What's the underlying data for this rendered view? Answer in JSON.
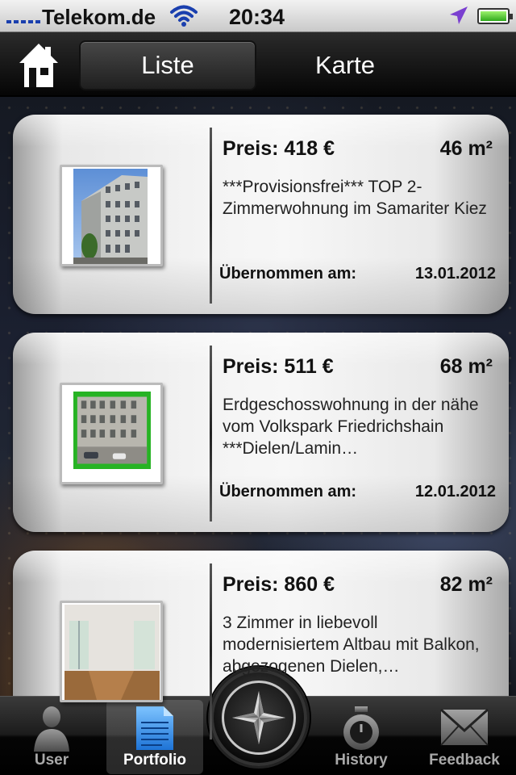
{
  "status_bar": {
    "carrier": "Telekom.de",
    "time": "20:34"
  },
  "nav": {
    "tabs": [
      {
        "label": "Liste",
        "active": true
      },
      {
        "label": "Karte",
        "active": false
      }
    ]
  },
  "listings": [
    {
      "price": "Preis: 418 €",
      "area": "46 m²",
      "description": "***Provisionsfrei*** TOP 2-Zimmerwohnung im Samariter Kiez",
      "taken_label": "Übernommen am:",
      "date": "13.01.2012"
    },
    {
      "price": "Preis: 511 €",
      "area": "68 m²",
      "description": "Erdgeschosswohnung in der nähe vom Volkspark Friedrichshain  ***Dielen/Lamin…",
      "taken_label": "Übernommen am:",
      "date": "12.01.2012"
    },
    {
      "price": "Preis: 860 €",
      "area": "82 m²",
      "description": "3 Zimmer in liebevoll modernisiertem Altbau mit Balkon, abgezogenen Dielen,…",
      "taken_label": "",
      "date": ""
    }
  ],
  "tab_bar": {
    "items": [
      {
        "label": "User",
        "icon": "user-icon",
        "active": false
      },
      {
        "label": "Portfolio",
        "icon": "document-icon",
        "active": true
      },
      {
        "label": "History",
        "icon": "stopwatch-icon",
        "active": false
      },
      {
        "label": "Feedback",
        "icon": "envelope-icon",
        "active": false
      }
    ],
    "center_icon": "compass-icon"
  },
  "colors": {
    "nav_bg": "#111111",
    "card_bg": "#f4f4f4",
    "signal": "#1a3fae",
    "battery": "#2fa91c",
    "location_arrow": "#7a3fd0"
  }
}
